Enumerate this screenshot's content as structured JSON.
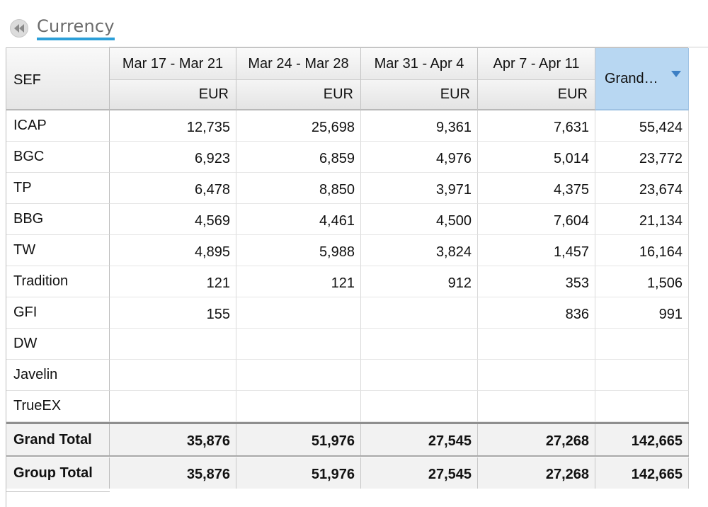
{
  "breadcrumb": {
    "label": "Currency"
  },
  "table": {
    "row_header": "SEF",
    "weeks": [
      "Mar 17 - Mar 21",
      "Mar 24 - Mar 28",
      "Mar 31 - Apr 4",
      "Apr 7 - Apr 11"
    ],
    "currency": "EUR",
    "grand_header": "Grand…",
    "rows": [
      {
        "label": "ICAP",
        "values": [
          "12,735",
          "25,698",
          "9,361",
          "7,631",
          "55,424"
        ]
      },
      {
        "label": "BGC",
        "values": [
          "6,923",
          "6,859",
          "4,976",
          "5,014",
          "23,772"
        ]
      },
      {
        "label": "TP",
        "values": [
          "6,478",
          "8,850",
          "3,971",
          "4,375",
          "23,674"
        ]
      },
      {
        "label": "BBG",
        "values": [
          "4,569",
          "4,461",
          "4,500",
          "7,604",
          "21,134"
        ]
      },
      {
        "label": "TW",
        "values": [
          "4,895",
          "5,988",
          "3,824",
          "1,457",
          "16,164"
        ]
      },
      {
        "label": "Tradition",
        "values": [
          "121",
          "121",
          "912",
          "353",
          "1,506"
        ]
      },
      {
        "label": "GFI",
        "values": [
          "155",
          "",
          "",
          "836",
          "991"
        ]
      },
      {
        "label": "DW",
        "values": [
          "",
          "",
          "",
          "",
          ""
        ]
      },
      {
        "label": "Javelin",
        "values": [
          "",
          "",
          "",
          "",
          ""
        ]
      },
      {
        "label": "TrueEX",
        "values": [
          "",
          "",
          "",
          "",
          ""
        ]
      }
    ],
    "totals": [
      {
        "label": "Grand Total",
        "values": [
          "35,876",
          "51,976",
          "27,545",
          "27,268",
          "142,665"
        ]
      },
      {
        "label": "Group Total",
        "values": [
          "35,876",
          "51,976",
          "27,545",
          "27,268",
          "142,665"
        ]
      }
    ]
  },
  "colors": {
    "accent": "#2c9fd8",
    "selected_header": "#b8d7f2"
  }
}
